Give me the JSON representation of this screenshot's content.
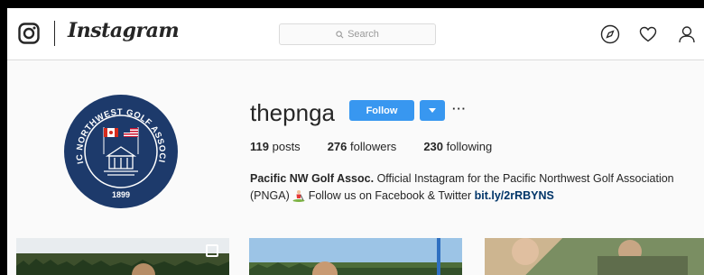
{
  "nav": {
    "brand": "Instagram",
    "search_placeholder": "Search",
    "icons": [
      "instagram-icon",
      "explore-compass-icon",
      "heart-icon",
      "user-icon"
    ]
  },
  "profile": {
    "username": "thepnga",
    "follow_label": "Follow",
    "more_label": "···",
    "stats": {
      "posts_count": "119",
      "posts_label": "posts",
      "followers_count": "276",
      "followers_label": "followers",
      "following_count": "230",
      "following_label": "following"
    },
    "bio": {
      "name": "Pacific NW Golf Assoc.",
      "text_1": "Official Instagram for the Pacific Northwest Golf Association (PNGA)",
      "text_2": "Follow us on Facebook & Twitter",
      "link": "bit.ly/2rRBYNS"
    },
    "avatar_logo": {
      "ring_text": "PACIFIC NORTHWEST GOLF ASSOCIATION",
      "year": "1899"
    }
  },
  "colors": {
    "accent": "#3897f0",
    "link": "#003569",
    "logo_navy": "#1d3a6b"
  }
}
